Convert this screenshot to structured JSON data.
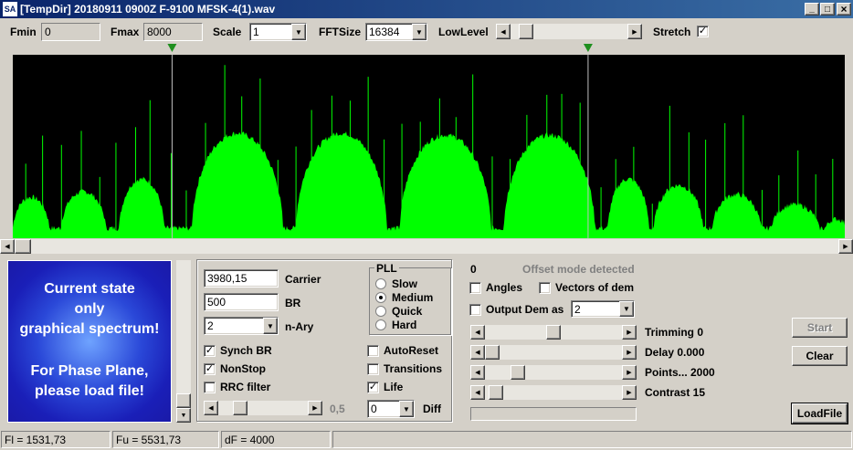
{
  "window": {
    "app_icon_text": "SA",
    "title": "[TempDir] 20180911 0900Z F-9100 MFSK-4(1).wav",
    "title_bg": "#0a246a",
    "minimize": "_",
    "maximize": "□",
    "close": "×"
  },
  "toolbar": {
    "fmin_label": "Fmin",
    "fmin_value": "0",
    "fmax_label": "Fmax",
    "fmax_value": "8000",
    "scale_label": "Scale",
    "scale_value": "1",
    "fftsize_label": "FFTSize",
    "fftsize_value": "16384",
    "lowlevel_label": "LowLevel",
    "lowlevel_position": 0.08,
    "stretch_label": "Stretch",
    "stretch_checked": true
  },
  "spectrum": {
    "background": "#000000",
    "color": "#00ff00",
    "marker_color": "#1f8f1f",
    "cursor_left_freq": 1531.73,
    "cursor_right_freq": 5531.73,
    "fmin": 0,
    "fmax": 8000
  },
  "info_panel": {
    "line1": "Current state",
    "line2": "only",
    "line3": "graphical spectrum!",
    "line4": "For Phase Plane,",
    "line5": "please load file!"
  },
  "demod": {
    "carrier_value": "3980,15",
    "carrier_label": "Carrier",
    "br_value": "500",
    "br_label": "BR",
    "nary_value": "2",
    "nary_label": "n-Ary",
    "synch_br_label": "Synch BR",
    "synch_br_checked": true,
    "nonstop_label": "NonStop",
    "nonstop_checked": true,
    "rrc_label": "RRC filter",
    "rrc_checked": false,
    "slider_value": "0,5",
    "pll_title": "PLL",
    "pll_options": [
      "Slow",
      "Medium",
      "Quick",
      "Hard"
    ],
    "pll_selected": "Medium",
    "autoreset_label": "AutoReset",
    "autoreset_checked": false,
    "transitions_label": "Transitions",
    "transitions_checked": false,
    "life_label": "Life",
    "life_checked": true,
    "diff_value": "0",
    "diff_label": "Diff"
  },
  "right": {
    "counter": "0",
    "offset_status": "Offset mode detected",
    "angles_label": "Angles",
    "angles_checked": false,
    "vectors_label": "Vectors of dem",
    "vectors_checked": false,
    "output_label": "Output Dem as",
    "output_checked": false,
    "output_value": "2",
    "trimming_label": "Trimming 0",
    "delay_label": "Delay  0.000",
    "points_label": "Points... 2000",
    "contrast_label": "Contrast 15",
    "start_label": "Start",
    "clear_label": "Clear",
    "loadfile_label": "LoadFile"
  },
  "status": {
    "fl": "Fl = 1531,73",
    "fu": "Fu = 5531,73",
    "df": "dF = 4000"
  }
}
